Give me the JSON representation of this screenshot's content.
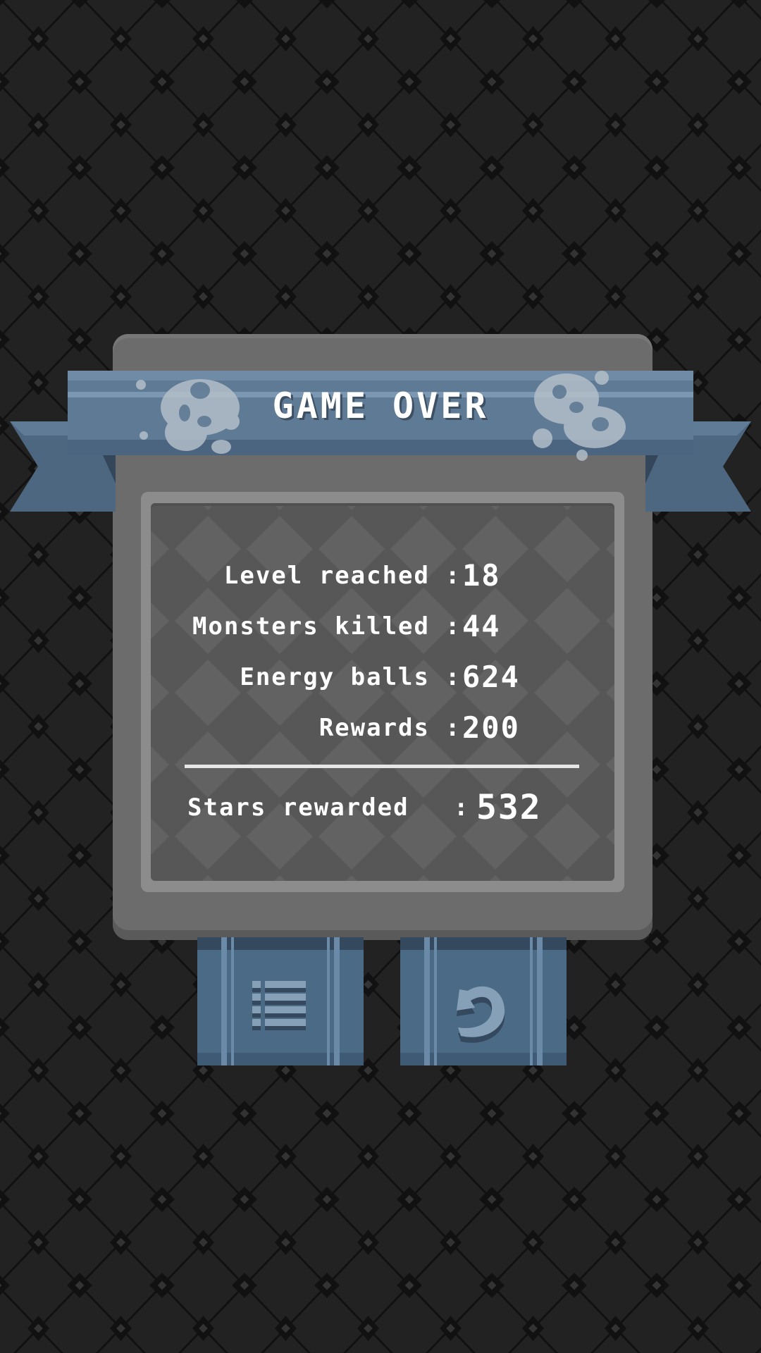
{
  "dialog": {
    "title": "GAME OVER",
    "stats": [
      {
        "label": "Level reached",
        "value": "18"
      },
      {
        "label": "Monsters killed",
        "value": "44"
      },
      {
        "label": "Energy balls",
        "value": "624"
      },
      {
        "label": "Rewards",
        "value": "200"
      }
    ],
    "total": {
      "label": "Stars rewarded",
      "value": "532"
    },
    "separator": ":"
  },
  "buttons": {
    "menu_icon": "list-menu-icon",
    "next_icon": "replay-arrow-icon"
  },
  "colors": {
    "background": "#222222",
    "panel": "#6c6c6c",
    "ribbon": "#5e7a94",
    "button": "#4b6a86"
  }
}
